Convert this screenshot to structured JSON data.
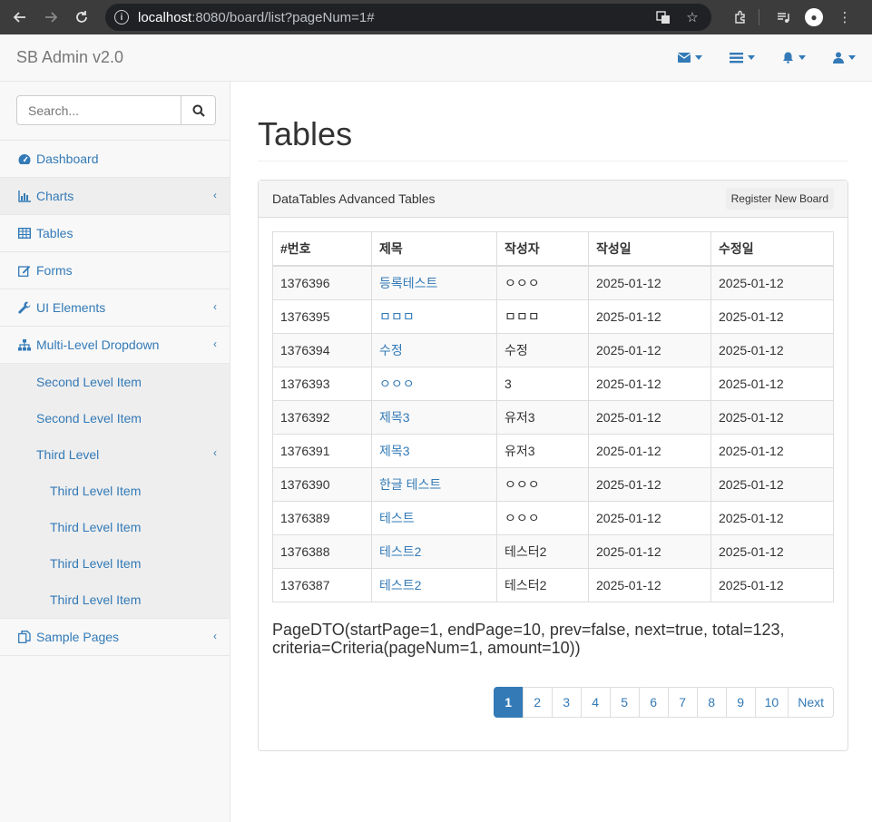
{
  "browser": {
    "url_host": "localhost",
    "url_path": ":8080/board/list?pageNum=1#"
  },
  "navbar": {
    "brand": "SB Admin v2.0"
  },
  "sidebar": {
    "search_placeholder": "Search...",
    "items": [
      {
        "label": "Dashboard",
        "icon": "dashboard-icon"
      },
      {
        "label": "Charts",
        "icon": "bar-chart-icon"
      },
      {
        "label": "Tables",
        "icon": "table-icon"
      },
      {
        "label": "Forms",
        "icon": "edit-icon"
      },
      {
        "label": "UI Elements",
        "icon": "wrench-icon"
      },
      {
        "label": "Multi-Level Dropdown",
        "icon": "sitemap-icon"
      },
      {
        "label": "Sample Pages",
        "icon": "files-icon"
      }
    ],
    "second_level": [
      "Second Level Item",
      "Second Level Item",
      "Third Level"
    ],
    "third_level": [
      "Third Level Item",
      "Third Level Item",
      "Third Level Item",
      "Third Level Item"
    ]
  },
  "main": {
    "title": "Tables",
    "panel_title": "DataTables Advanced Tables",
    "register_button": "Register New Board",
    "table": {
      "headers": [
        "#번호",
        "제목",
        "작성자",
        "작성일",
        "수정일"
      ],
      "rows": [
        [
          "1376396",
          "등록테스트",
          "ㅇㅇㅇ",
          "2025-01-12",
          "2025-01-12"
        ],
        [
          "1376395",
          "ㅁㅁㅁ",
          "ㅁㅁㅁ",
          "2025-01-12",
          "2025-01-12"
        ],
        [
          "1376394",
          "수정",
          "수정",
          "2025-01-12",
          "2025-01-12"
        ],
        [
          "1376393",
          "ㅇㅇㅇ",
          "3",
          "2025-01-12",
          "2025-01-12"
        ],
        [
          "1376392",
          "제목3",
          "유저3",
          "2025-01-12",
          "2025-01-12"
        ],
        [
          "1376391",
          "제목3",
          "유저3",
          "2025-01-12",
          "2025-01-12"
        ],
        [
          "1376390",
          "한글 테스트",
          "ㅇㅇㅇ",
          "2025-01-12",
          "2025-01-12"
        ],
        [
          "1376389",
          "테스트",
          "ㅇㅇㅇ",
          "2025-01-12",
          "2025-01-12"
        ],
        [
          "1376388",
          "테스트2",
          "테스터2",
          "2025-01-12",
          "2025-01-12"
        ],
        [
          "1376387",
          "테스트2",
          "테스터2",
          "2025-01-12",
          "2025-01-12"
        ]
      ]
    },
    "pagedto_line1": "PageDTO(startPage=1, endPage=10, prev=false, next=true, total=123,",
    "pagedto_line2": "criteria=Criteria(pageNum=1, amount=10))",
    "pagination": [
      "1",
      "2",
      "3",
      "4",
      "5",
      "6",
      "7",
      "8",
      "9",
      "10",
      "Next"
    ],
    "active_page": "1"
  },
  "colors": {
    "link": "#337ab7",
    "chrome_bg": "#3c3c3c"
  }
}
